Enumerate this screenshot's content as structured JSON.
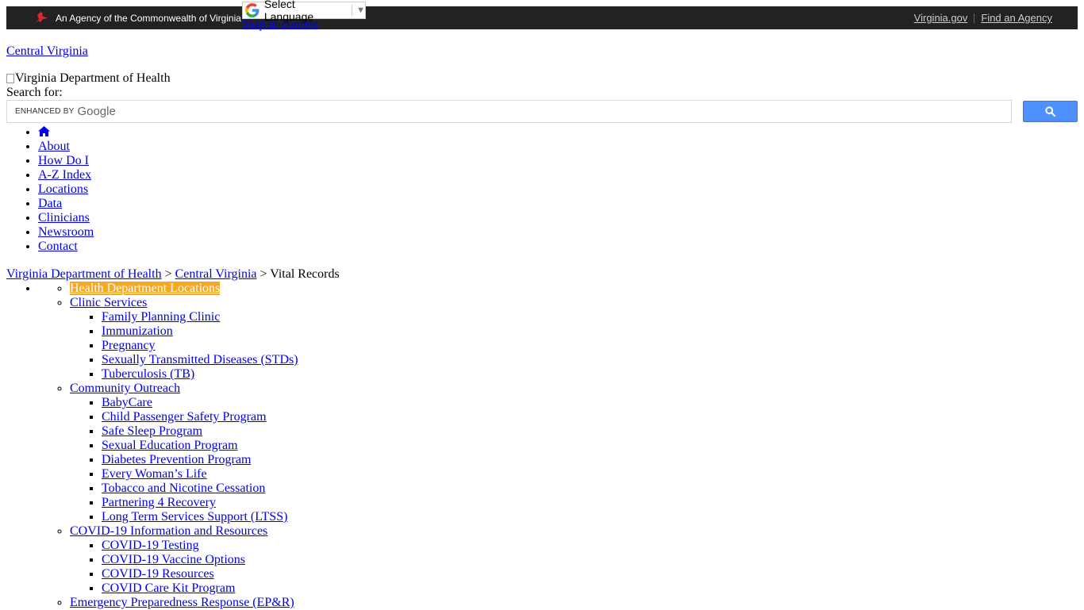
{
  "topbar": {
    "agency_text": "An Agency of the Commonwealth of Virginia",
    "links": [
      "Virginia.gov",
      "Find an Agency"
    ]
  },
  "translate": {
    "label": "Select Language"
  },
  "skip_link": "Skip to content",
  "site_link": "Central Virginia",
  "logo_alt": "Virginia Department of Health",
  "search": {
    "label": "Search for:",
    "enhanced_by": "ENHANCED BY",
    "google": "Google"
  },
  "nav": {
    "items": [
      "About",
      "How Do I",
      "A-Z Index",
      "Locations",
      "Data",
      "Clinicians",
      "Newsroom",
      "Contact"
    ]
  },
  "breadcrumb": {
    "items": [
      "Virginia Department of Health",
      "Central Virginia",
      "Vital Records"
    ],
    "separator": ">"
  },
  "side_menu": {
    "health_dept_locations": "Health Department Locations",
    "clinic_services": {
      "label": "Clinic Services",
      "children": [
        "Family Planning Clinic",
        "Immunization",
        "Pregnancy",
        "Sexually Transmitted Diseases (STDs)",
        "Tuberculosis (TB)"
      ]
    },
    "community_outreach": {
      "label": "Community Outreach",
      "children": [
        "BabyCare",
        "Child Passenger Safety Program",
        "Safe Sleep Program",
        "Sexual Education Program",
        "Diabetes Prevention Program",
        "Every Woman’s Life",
        "Tobacco and Nicotine Cessation",
        "Partnering 4 Recovery",
        "Long Term Services Support (LTSS)"
      ]
    },
    "covid": {
      "label": "COVID-19 Information and Resources",
      "children": [
        "COVID-19 Testing",
        "COVID-19 Vaccine Options",
        "COVID-19 Resources",
        "COVID Care Kit Program"
      ]
    },
    "emergency": "Emergency Preparedness Response (EP&R)"
  },
  "colors": {
    "topbar_bg": "#222222",
    "link": "#0000ee",
    "highlight": "#f7a823",
    "search_button": "#4d90fe"
  }
}
